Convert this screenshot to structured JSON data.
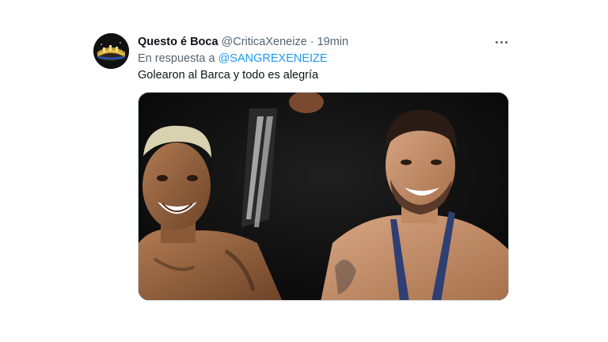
{
  "tweet": {
    "display_name": "Questo é Boca",
    "handle": "@CriticaXeneize",
    "separator": "·",
    "time": "19min",
    "reply_prefix": "En respuesta a",
    "reply_mention": "@SANGREXENEIZE",
    "text": "Golearon al Barca y todo es alegría",
    "more_icon": "more-horizontal-icon",
    "media_description_icon": "photo-media"
  },
  "colors": {
    "name": "#0f1419",
    "secondary": "#536471",
    "link": "#1d9bf0",
    "border": "#cfd9de"
  }
}
